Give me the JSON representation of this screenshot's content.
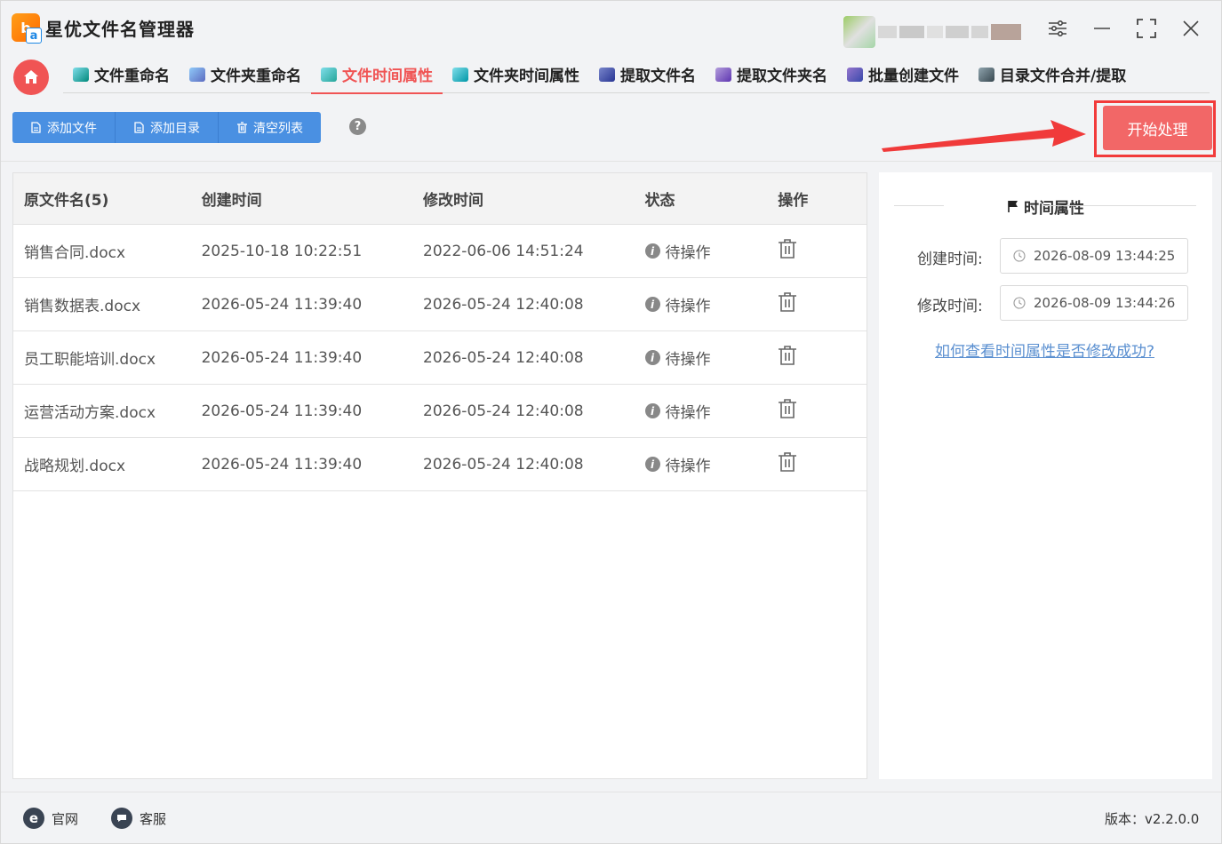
{
  "app": {
    "title": "星优文件名管理器",
    "logo_letter": "b",
    "logo_sub": "a"
  },
  "tabs": [
    {
      "label": "文件重命名",
      "active": false
    },
    {
      "label": "文件夹重命名",
      "active": false
    },
    {
      "label": "文件时间属性",
      "active": true
    },
    {
      "label": "文件夹时间属性",
      "active": false
    },
    {
      "label": "提取文件名",
      "active": false
    },
    {
      "label": "提取文件夹名",
      "active": false
    },
    {
      "label": "批量创建文件",
      "active": false
    },
    {
      "label": "目录文件合并/提取",
      "active": false
    }
  ],
  "toolbar": {
    "add_file": "添加文件",
    "add_dir": "添加目录",
    "clear_list": "清空列表",
    "help": "?",
    "start": "开始处理"
  },
  "table": {
    "headers": {
      "name": "原文件名(5)",
      "created": "创建时间",
      "modified": "修改时间",
      "status": "状态",
      "action": "操作"
    },
    "rows": [
      {
        "name": "销售合同.docx",
        "created": "2025-10-18 10:22:51",
        "modified": "2022-06-06 14:51:24",
        "status": "待操作"
      },
      {
        "name": "销售数据表.docx",
        "created": "2026-05-24 11:39:40",
        "modified": "2026-05-24 12:40:08",
        "status": "待操作"
      },
      {
        "name": "员工职能培训.docx",
        "created": "2026-05-24 11:39:40",
        "modified": "2026-05-24 12:40:08",
        "status": "待操作"
      },
      {
        "name": "运营活动方案.docx",
        "created": "2026-05-24 11:39:40",
        "modified": "2026-05-24 12:40:08",
        "status": "待操作"
      },
      {
        "name": "战略规划.docx",
        "created": "2026-05-24 11:39:40",
        "modified": "2026-05-24 12:40:08",
        "status": "待操作"
      }
    ]
  },
  "side": {
    "title": "时间属性",
    "created_label": "创建时间:",
    "created_value": "2026-08-09 13:44:25",
    "modified_label": "修改时间:",
    "modified_value": "2026-08-09 13:44:26",
    "help_link": "如何查看时间属性是否修改成功?"
  },
  "footer": {
    "website": "官网",
    "support": "客服",
    "version": "版本：v2.2.0.0"
  },
  "colors": {
    "accent": "#f05454",
    "primary": "#4a90e2",
    "start": "#f26767",
    "link": "#5a8fd0"
  },
  "icons": {
    "window": [
      "settings-sliders-icon",
      "minimize-icon",
      "maximize-icon",
      "close-icon"
    ],
    "home": "home-icon",
    "row_action": "trash-icon",
    "status": "info-icon"
  }
}
